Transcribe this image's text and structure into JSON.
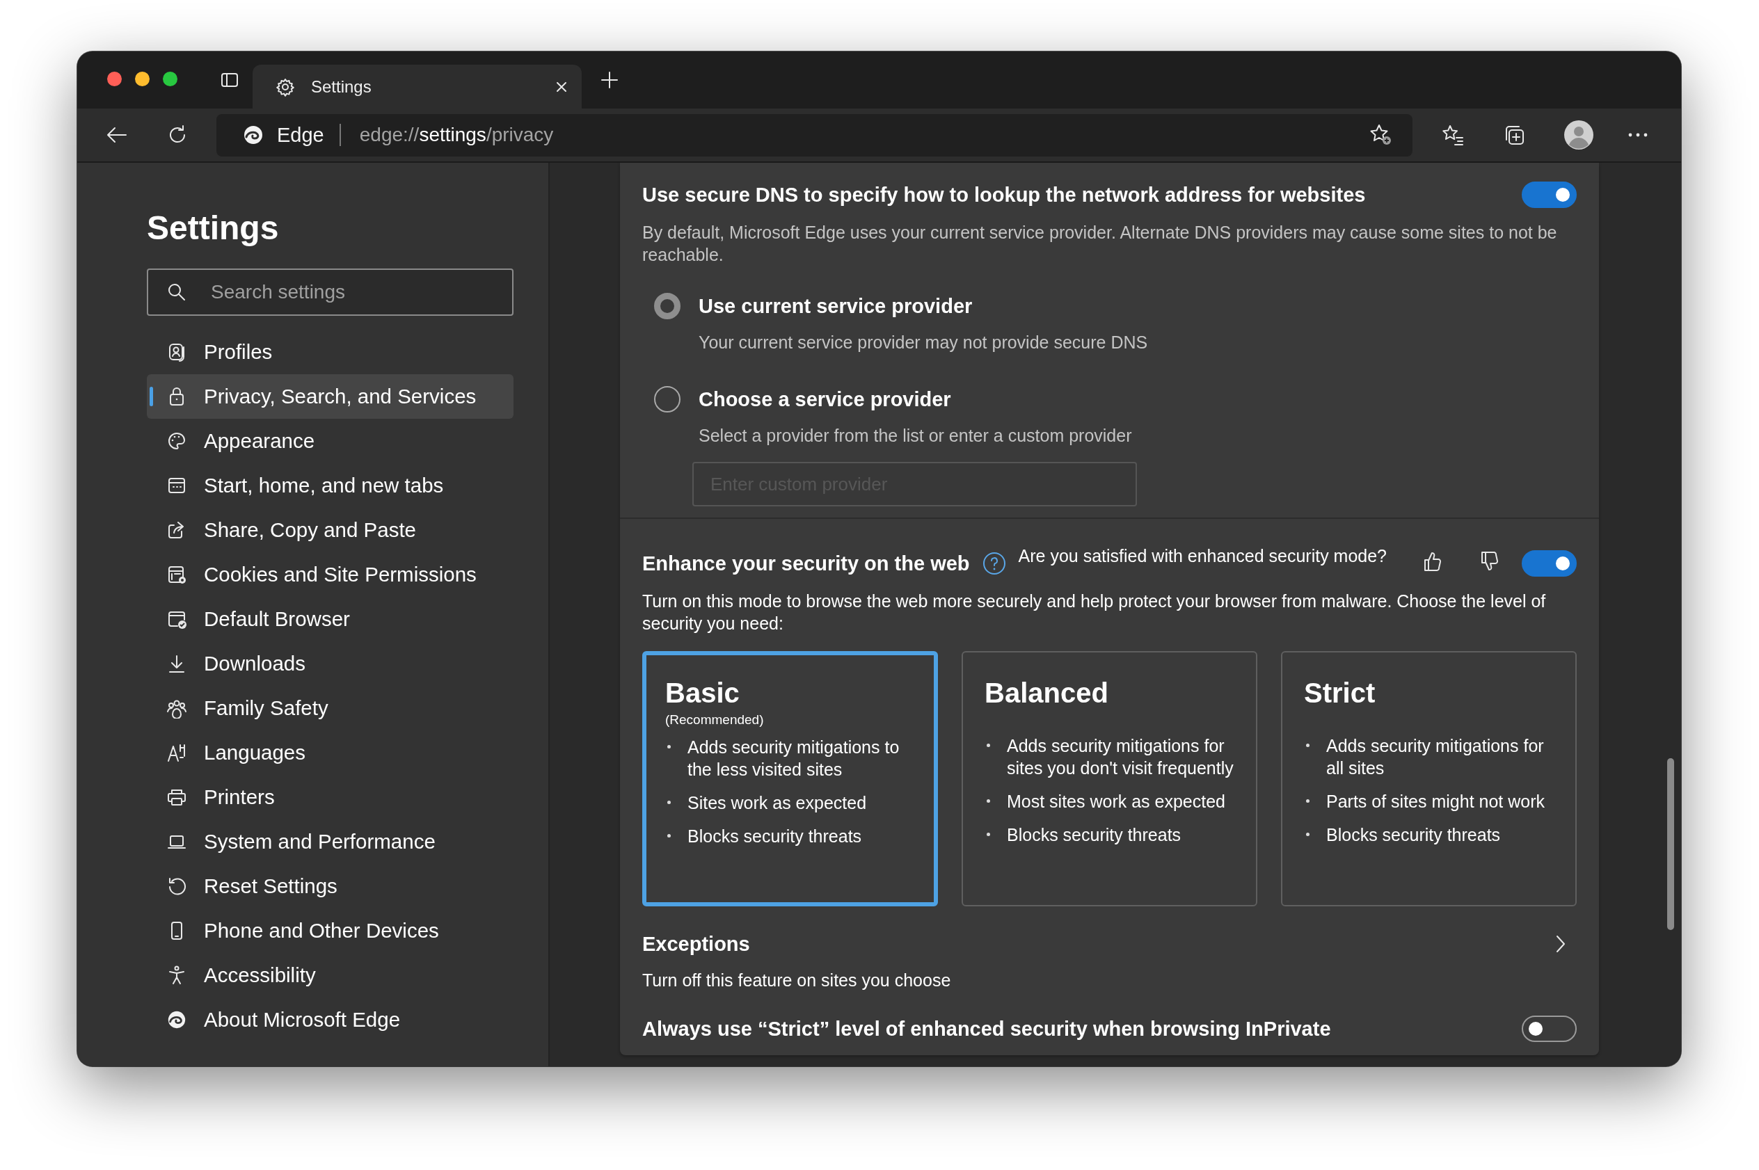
{
  "window": {
    "traffic_lights": [
      {
        "color": "#ff5f57"
      },
      {
        "color": "#febc2e"
      },
      {
        "color": "#28c840"
      }
    ]
  },
  "tabs": [
    {
      "title": "Settings",
      "selected": true
    }
  ],
  "address_bar": {
    "site_label": "Edge",
    "url": [
      {
        "text": "edge://",
        "emphasis": false
      },
      {
        "text": "settings",
        "emphasis": true
      },
      {
        "text": "/privacy",
        "emphasis": false
      }
    ]
  },
  "sidebar": {
    "title": "Settings",
    "search": {
      "placeholder": "Search settings"
    },
    "items": [
      {
        "label": "Profiles",
        "selected": false
      },
      {
        "label": "Privacy, Search, and Services",
        "selected": true
      },
      {
        "label": "Appearance",
        "selected": false
      },
      {
        "label": "Start, home, and new tabs",
        "selected": false
      },
      {
        "label": "Share, Copy and Paste",
        "selected": false
      },
      {
        "label": "Cookies and Site Permissions",
        "selected": false
      },
      {
        "label": "Default Browser",
        "selected": false
      },
      {
        "label": "Downloads",
        "selected": false
      },
      {
        "label": "Family Safety",
        "selected": false
      },
      {
        "label": "Languages",
        "selected": false
      },
      {
        "label": "Printers",
        "selected": false
      },
      {
        "label": "System and Performance",
        "selected": false
      },
      {
        "label": "Reset Settings",
        "selected": false
      },
      {
        "label": "Phone and Other Devices",
        "selected": false
      },
      {
        "label": "Accessibility",
        "selected": false
      },
      {
        "label": "About Microsoft Edge",
        "selected": false
      }
    ]
  },
  "dns": {
    "title": "Use secure DNS to specify how to lookup the network address for websites",
    "on": true,
    "description": "By default, Microsoft Edge uses your current service provider. Alternate DNS providers may cause some sites to not be reachable.",
    "options": [
      {
        "label": "Use current service provider",
        "description": "Your current service provider may not provide secure DNS",
        "selected": true
      },
      {
        "label": "Choose a service provider",
        "description": "Select a provider from the list or enter a custom provider",
        "selected": false
      }
    ],
    "custom_provider": {
      "placeholder": "Enter custom provider",
      "disabled": true
    }
  },
  "enhanced_security": {
    "title": "Enhance your security on the web",
    "feedback_question": "Are you satisfied with enhanced security mode?",
    "on": true,
    "description": "Turn on this mode to browse the web more securely and help protect your browser from malware. Choose the level of security you need:",
    "levels": [
      {
        "name": "Basic",
        "note": "(Recommended)",
        "selected": true,
        "bullets": [
          "Adds security mitigations to the less visited sites",
          "Sites work as expected",
          "Blocks security threats"
        ]
      },
      {
        "name": "Balanced",
        "selected": false,
        "bullets": [
          "Adds security mitigations for sites you don't visit frequently",
          "Most sites work as expected",
          "Blocks security threats"
        ]
      },
      {
        "name": "Strict",
        "selected": false,
        "bullets": [
          "Adds security mitigations for all sites",
          "Parts of sites might not work",
          "Blocks security threats"
        ]
      }
    ],
    "exceptions": {
      "title": "Exceptions",
      "description": "Turn off this feature on sites you choose"
    },
    "inprivate_strict": {
      "label": "Always use “Strict” level of enhanced security when browsing InPrivate",
      "on": false
    }
  }
}
